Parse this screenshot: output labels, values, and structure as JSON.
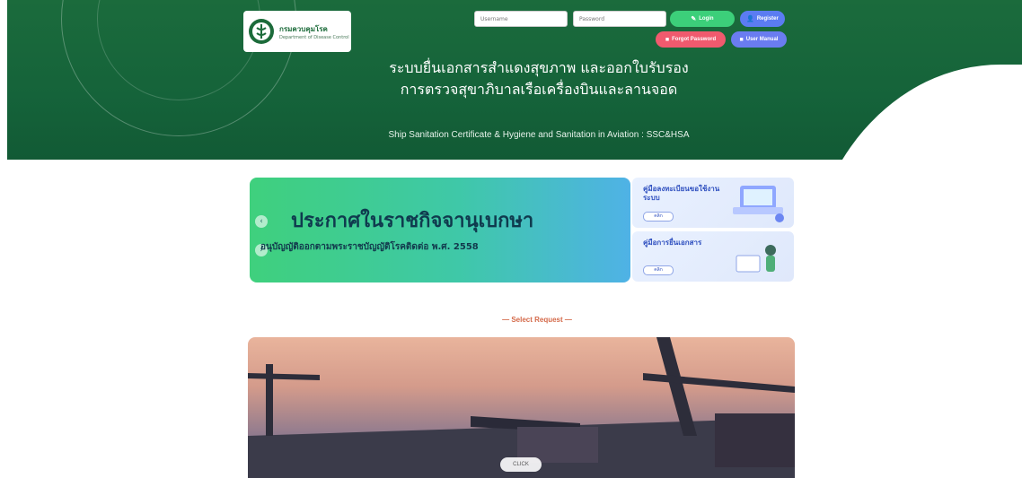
{
  "header": {
    "logo_text_th": "กรมควบคุมโรค",
    "logo_text_en": "Department of Disease Control",
    "title_th_line1": "ระบบยื่นเอกสารสำแดงสุขภาพ และออกใบรับรอง",
    "title_th_line2": "การตรวจสุขาภิบาลเรือเครื่องบินและลานจอด",
    "title_en": "Ship Sanitation Certificate & Hygiene and Sanitation in Aviation : SSC&HSA"
  },
  "auth": {
    "username_placeholder": "Username",
    "password_placeholder": "Password",
    "login_label": "Login",
    "register_label": "Register",
    "forgot_label": "Forgot Password",
    "manual_label": "User Manual"
  },
  "banner": {
    "title": "ประกาศในราชกิจจานุเบกษา",
    "subtitle": "อนุบัญญัติออกตามพระราชบัญญัติโรคติดต่อ พ.ศ. 2558"
  },
  "side_cards": [
    {
      "title": "คู่มือลงทะเบียนขอใช้งานระบบ",
      "button": "คลิก"
    },
    {
      "title": "คู่มือการยื่นเอกสาร",
      "button": "คลิก"
    }
  ],
  "select_request": "— Select Request —",
  "photo": {
    "button": "CLICK"
  },
  "colors": {
    "header_green": "#1b6b3c",
    "login_green": "#3ccf7a",
    "register_blue": "#5b7cf2",
    "forgot_red": "#f05a6e",
    "manual_blue": "#6a7cf0"
  }
}
